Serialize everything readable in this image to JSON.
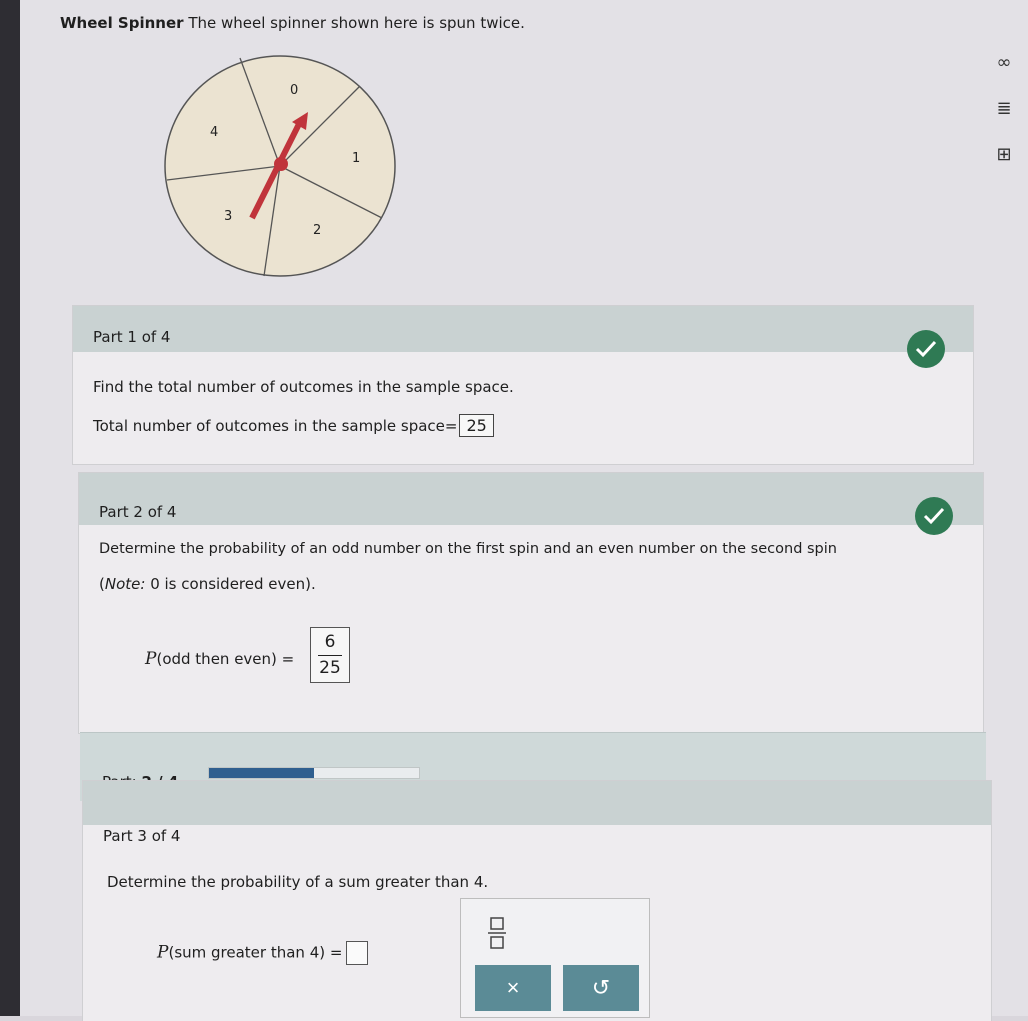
{
  "problem": {
    "title_bold": "Wheel Spinner",
    "title_text": "The wheel spinner shown here is spun twice."
  },
  "side_tools": [
    {
      "icon": "infinity-icon",
      "glyph": "∞"
    },
    {
      "icon": "notes-icon",
      "glyph": "≣"
    },
    {
      "icon": "calculator-icon",
      "glyph": "⊞"
    }
  ],
  "wheel": {
    "sections": [
      "0",
      "1",
      "2",
      "3",
      "4"
    ],
    "fill_color": "#ebe3d1",
    "pointer_color": "#c0343b"
  },
  "part1": {
    "header": "Part 1 of 4",
    "question": "Find the total number of outcomes in the sample space.",
    "answer_label": "Total number of outcomes in the sample space",
    "equals": "=",
    "answer": "25",
    "status": "correct"
  },
  "part2": {
    "header": "Part 2 of 4",
    "question": "Determine the probability of an odd number on the first spin and an even number on the second spin",
    "note_label": "Note:",
    "note_text": "0 is considered even).",
    "note_open": "(",
    "p_symbol": "P",
    "p_arg": "odd then even",
    "equals": "=",
    "numerator": "6",
    "denominator": "25",
    "status": "correct"
  },
  "progress": {
    "label": "Part:",
    "current": "2 / 4",
    "fraction_complete": 0.5,
    "fill_color": "#2f5f8f"
  },
  "part3": {
    "header": "Part 3 of 4",
    "question": "Determine the probability of a sum greater than 4.",
    "p_symbol": "P",
    "p_arg": "sum greater than 4",
    "equals": "="
  },
  "toolbar": {
    "fraction_tool": "fraction-icon",
    "clear_glyph": "×",
    "undo_glyph": "↺"
  }
}
